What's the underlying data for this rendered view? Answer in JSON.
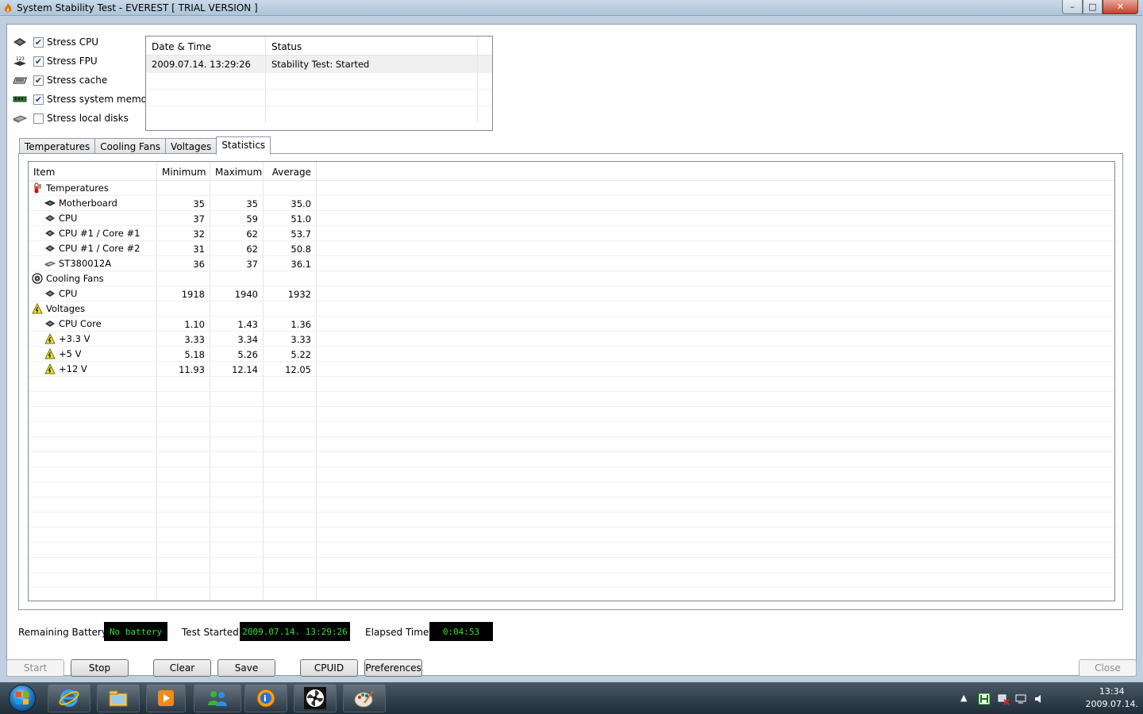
{
  "window": {
    "title": "System Stability Test - EVEREST  [ TRIAL VERSION ]",
    "controls": {
      "minimize": "–",
      "maximize": "□",
      "close": "✕"
    }
  },
  "stress_options": [
    {
      "label": "Stress CPU",
      "checked": true,
      "icon": "cpu-chip-icon"
    },
    {
      "label": "Stress FPU",
      "checked": true,
      "icon": "fpu-icon"
    },
    {
      "label": "Stress cache",
      "checked": true,
      "icon": "cache-icon"
    },
    {
      "label": "Stress system memory",
      "checked": true,
      "icon": "memory-icon"
    },
    {
      "label": "Stress local disks",
      "checked": false,
      "icon": "disk-icon"
    }
  ],
  "log": {
    "headers": [
      "Date & Time",
      "Status"
    ],
    "rows": [
      {
        "datetime": "2009.07.14. 13:29:26",
        "status": "Stability Test: Started"
      }
    ]
  },
  "tabs": [
    {
      "label": "Temperatures",
      "active": false
    },
    {
      "label": "Cooling Fans",
      "active": false
    },
    {
      "label": "Voltages",
      "active": false
    },
    {
      "label": "Statistics",
      "active": true
    }
  ],
  "statistics": {
    "headers": {
      "item": "Item",
      "min": "Minimum",
      "max": "Maximum",
      "avg": "Average"
    },
    "rows": [
      {
        "name": "Temperatures",
        "min": "",
        "max": "",
        "avg": "",
        "group": true,
        "icon": "thermometer-icon"
      },
      {
        "name": "Motherboard",
        "min": "35",
        "max": "35",
        "avg": "35.0",
        "group": false,
        "icon": "motherboard-icon"
      },
      {
        "name": "CPU",
        "min": "37",
        "max": "59",
        "avg": "51.0",
        "group": false,
        "icon": "cpu-chip-icon"
      },
      {
        "name": "CPU #1 / Core #1",
        "min": "32",
        "max": "62",
        "avg": "53.7",
        "group": false,
        "icon": "cpu-chip-icon"
      },
      {
        "name": "CPU #1 / Core #2",
        "min": "31",
        "max": "62",
        "avg": "50.8",
        "group": false,
        "icon": "cpu-chip-icon"
      },
      {
        "name": "ST380012A",
        "min": "36",
        "max": "37",
        "avg": "36.1",
        "group": false,
        "icon": "disk-icon"
      },
      {
        "name": "Cooling Fans",
        "min": "",
        "max": "",
        "avg": "",
        "group": true,
        "icon": "fan-icon"
      },
      {
        "name": "CPU",
        "min": "1918",
        "max": "1940",
        "avg": "1932",
        "group": false,
        "icon": "cpu-chip-icon"
      },
      {
        "name": "Voltages",
        "min": "",
        "max": "",
        "avg": "",
        "group": true,
        "icon": "voltage-icon"
      },
      {
        "name": "CPU Core",
        "min": "1.10",
        "max": "1.43",
        "avg": "1.36",
        "group": false,
        "icon": "cpu-chip-icon"
      },
      {
        "name": "+3.3 V",
        "min": "3.33",
        "max": "3.34",
        "avg": "3.33",
        "group": false,
        "icon": "voltage-icon"
      },
      {
        "name": "+5 V",
        "min": "5.18",
        "max": "5.26",
        "avg": "5.22",
        "group": false,
        "icon": "voltage-icon"
      },
      {
        "name": "+12 V",
        "min": "11.93",
        "max": "12.14",
        "avg": "12.05",
        "group": false,
        "icon": "voltage-icon"
      }
    ]
  },
  "status_bar": {
    "battery_label": "Remaining Battery:",
    "battery_value": "No battery",
    "started_label": "Test Started:",
    "started_value": "2009.07.14. 13:29:26",
    "elapsed_label": "Elapsed Time:",
    "elapsed_value": "0:04:53"
  },
  "buttons": {
    "start": "Start",
    "stop": "Stop",
    "clear": "Clear",
    "save": "Save",
    "cpuid": "CPUID",
    "preferences": "Preferences",
    "close": "Close"
  },
  "taskbar": {
    "pinned": [
      "internet-explorer-icon",
      "file-explorer-icon",
      "media-player-icon",
      "messenger-icon",
      "everest-icon",
      "fan-app-icon",
      "paint-icon"
    ],
    "clock_time": "13:34",
    "clock_date": "2009.07.14."
  },
  "colors": {
    "led_text": "#2ee22e",
    "led_bg": "#000000",
    "titlebar": "#bfcfdf"
  }
}
